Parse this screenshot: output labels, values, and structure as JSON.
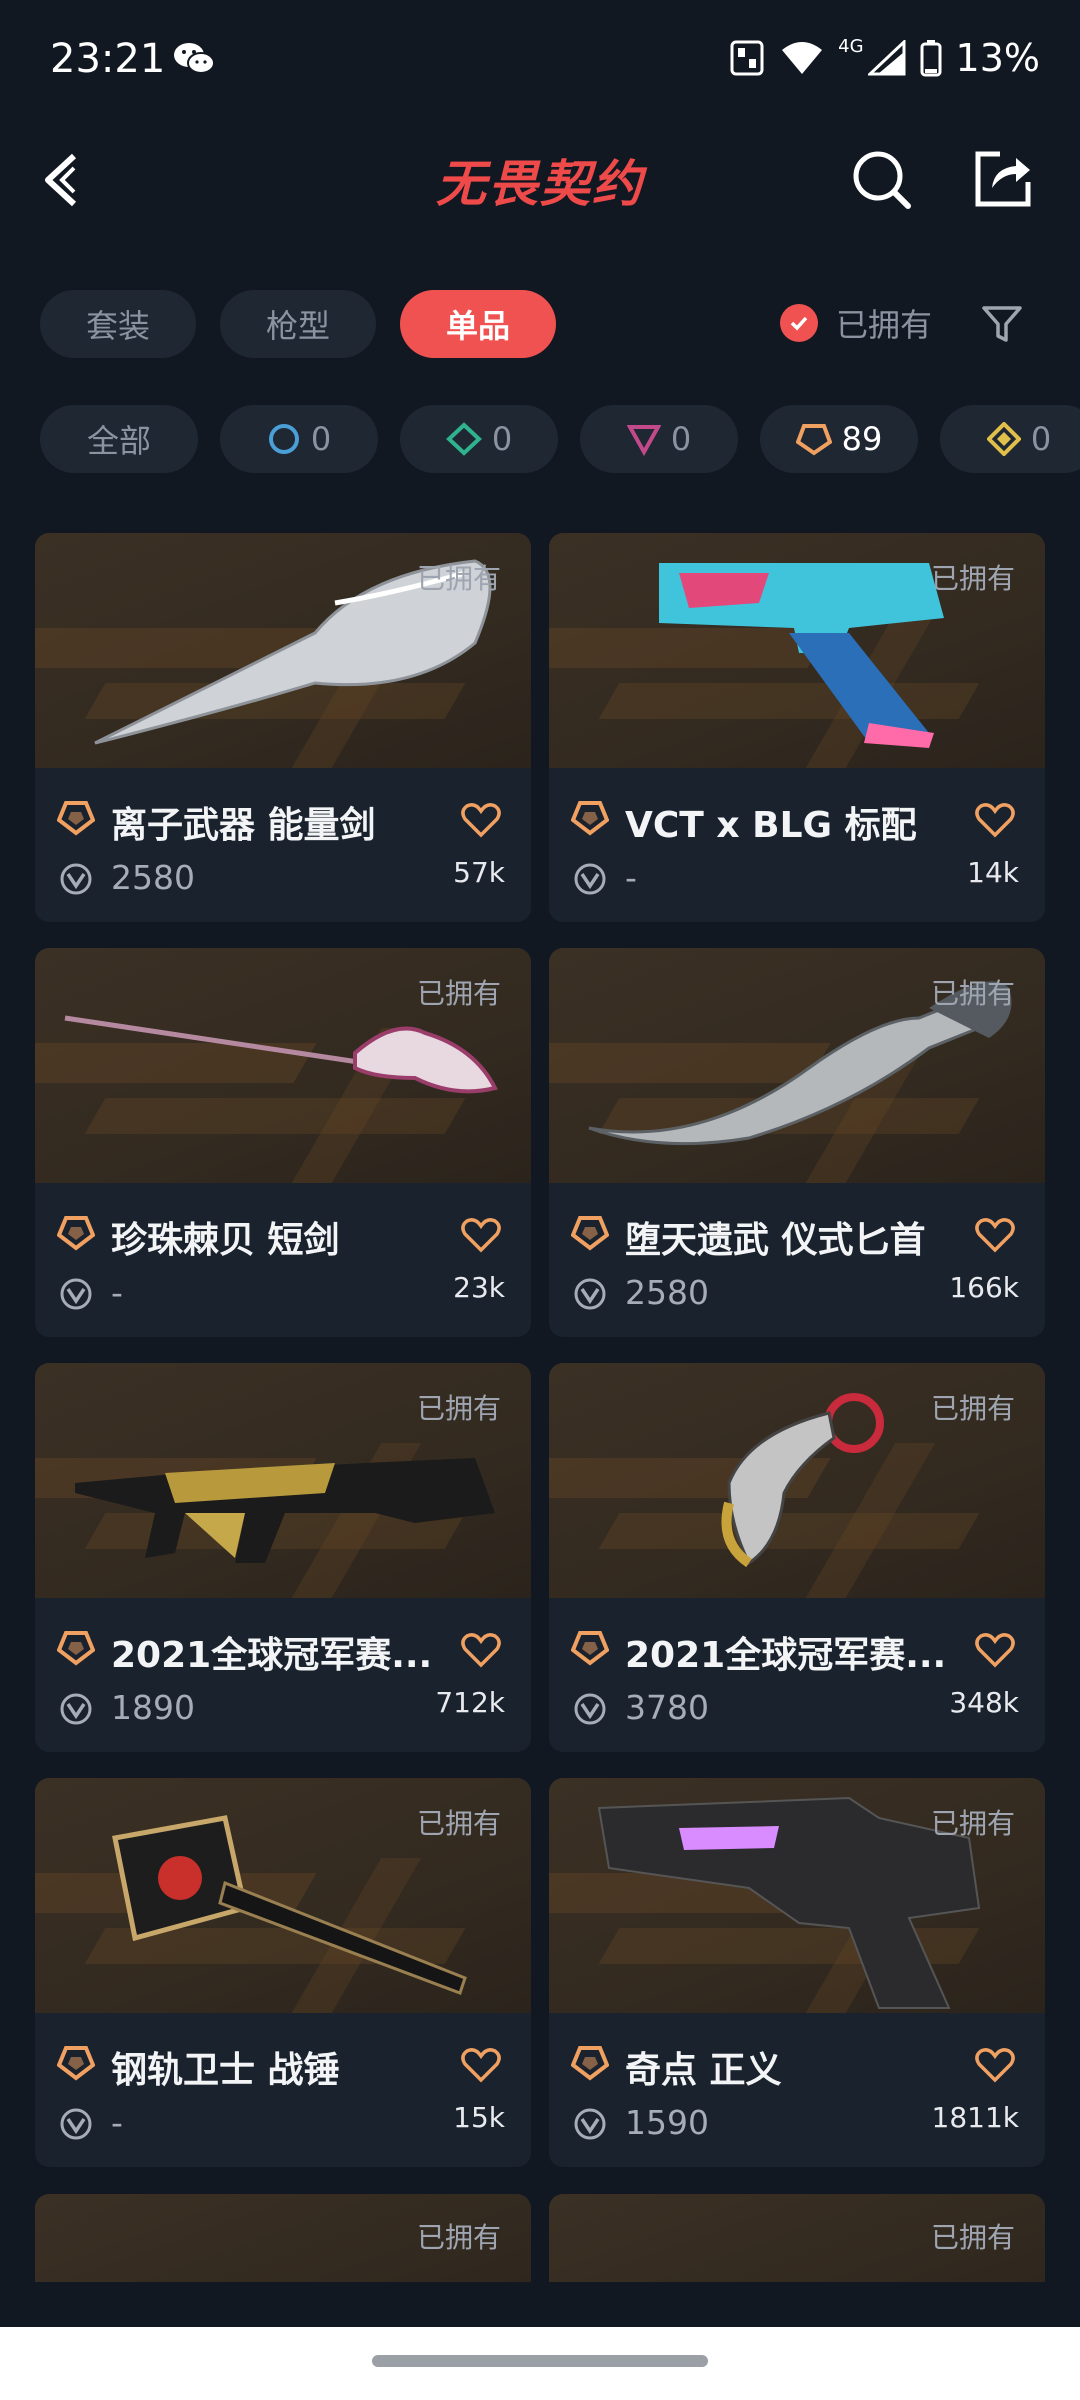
{
  "status_bar": {
    "time": "23:21",
    "battery": "13%",
    "network": "4G"
  },
  "header": {
    "brand": "无畏契约"
  },
  "category_tabs": [
    {
      "label": "套装",
      "active": false
    },
    {
      "label": "枪型",
      "active": false
    },
    {
      "label": "单品",
      "active": true
    }
  ],
  "owned_filter": {
    "label": "已拥有",
    "checked": true
  },
  "tier_filters": [
    {
      "label": "全部",
      "count": ""
    },
    {
      "tier": "select",
      "color": "#4a9fd6",
      "count": "0"
    },
    {
      "tier": "deluxe",
      "color": "#2fb38f",
      "count": "0"
    },
    {
      "tier": "premium",
      "color": "#c24a8a",
      "count": "0"
    },
    {
      "tier": "exclusive",
      "color": "#f0a060",
      "count": "89"
    },
    {
      "tier": "ultra",
      "color": "#e0c04a",
      "count": "0"
    }
  ],
  "owned_tag": "已拥有",
  "items": [
    {
      "name": "离子武器 能量剑",
      "price": "2580",
      "likes": "57k",
      "weapon": "energy-sword"
    },
    {
      "name": "VCT x BLG 标配",
      "price": "-",
      "likes": "14k",
      "weapon": "pistol"
    },
    {
      "name": "珍珠棘贝 短剑",
      "price": "-",
      "likes": "23k",
      "weapon": "rapier"
    },
    {
      "name": "堕天遗武 仪式匕首",
      "price": "2580",
      "likes": "166k",
      "weapon": "curved-dagger"
    },
    {
      "name": "2021全球冠军赛...",
      "price": "1890",
      "likes": "712k",
      "weapon": "rifle"
    },
    {
      "name": "2021全球冠军赛...",
      "price": "3780",
      "likes": "348k",
      "weapon": "karambit"
    },
    {
      "name": "钢轨卫士 战锤",
      "price": "-",
      "likes": "15k",
      "weapon": "hammer"
    },
    {
      "name": "奇点 正义",
      "price": "1590",
      "likes": "1811k",
      "weapon": "revolver"
    }
  ]
}
